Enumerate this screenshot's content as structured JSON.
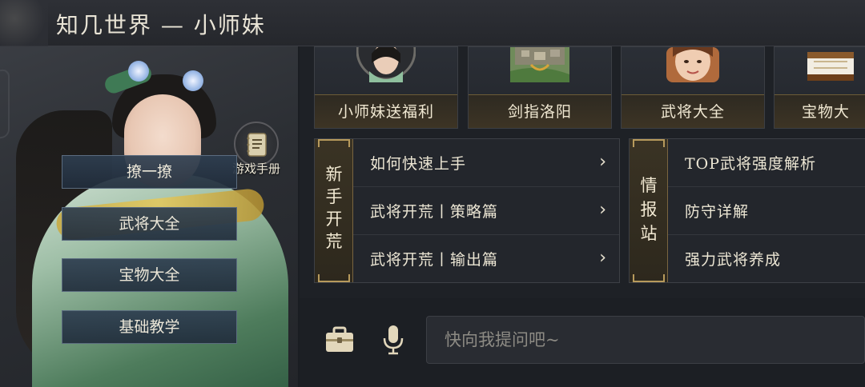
{
  "header": {
    "title": "知几世界 — 小师妹"
  },
  "left": {
    "manual_label": "游戏手册",
    "menu": [
      {
        "label": "撩一撩"
      },
      {
        "label": "武将大全"
      },
      {
        "label": "宝物大全"
      },
      {
        "label": "基础教学"
      }
    ]
  },
  "cards": [
    {
      "label": "小师妹送福利"
    },
    {
      "label": "剑指洛阳"
    },
    {
      "label": "武将大全"
    },
    {
      "label": "宝物大"
    }
  ],
  "sections": [
    {
      "side_label": [
        "新",
        "手",
        "开",
        "荒"
      ],
      "items": [
        {
          "label": "如何快速上手",
          "chevron": "›"
        },
        {
          "label": "武将开荒丨策略篇",
          "chevron": "›"
        },
        {
          "label": "武将开荒丨输出篇",
          "chevron": "›"
        }
      ]
    },
    {
      "side_label": [
        "情",
        "报",
        "站"
      ],
      "items": [
        {
          "label": "TOP武将强度解析"
        },
        {
          "label": "防守详解"
        },
        {
          "label": "强力武将养成"
        }
      ]
    }
  ],
  "chat": {
    "placeholder": "快向我提问吧~",
    "icons": [
      "briefcase-icon",
      "microphone-icon"
    ]
  },
  "colors": {
    "accent_gold": "#b79a5c",
    "menu_blue": "#2e3e50",
    "background": "#1e2126"
  }
}
